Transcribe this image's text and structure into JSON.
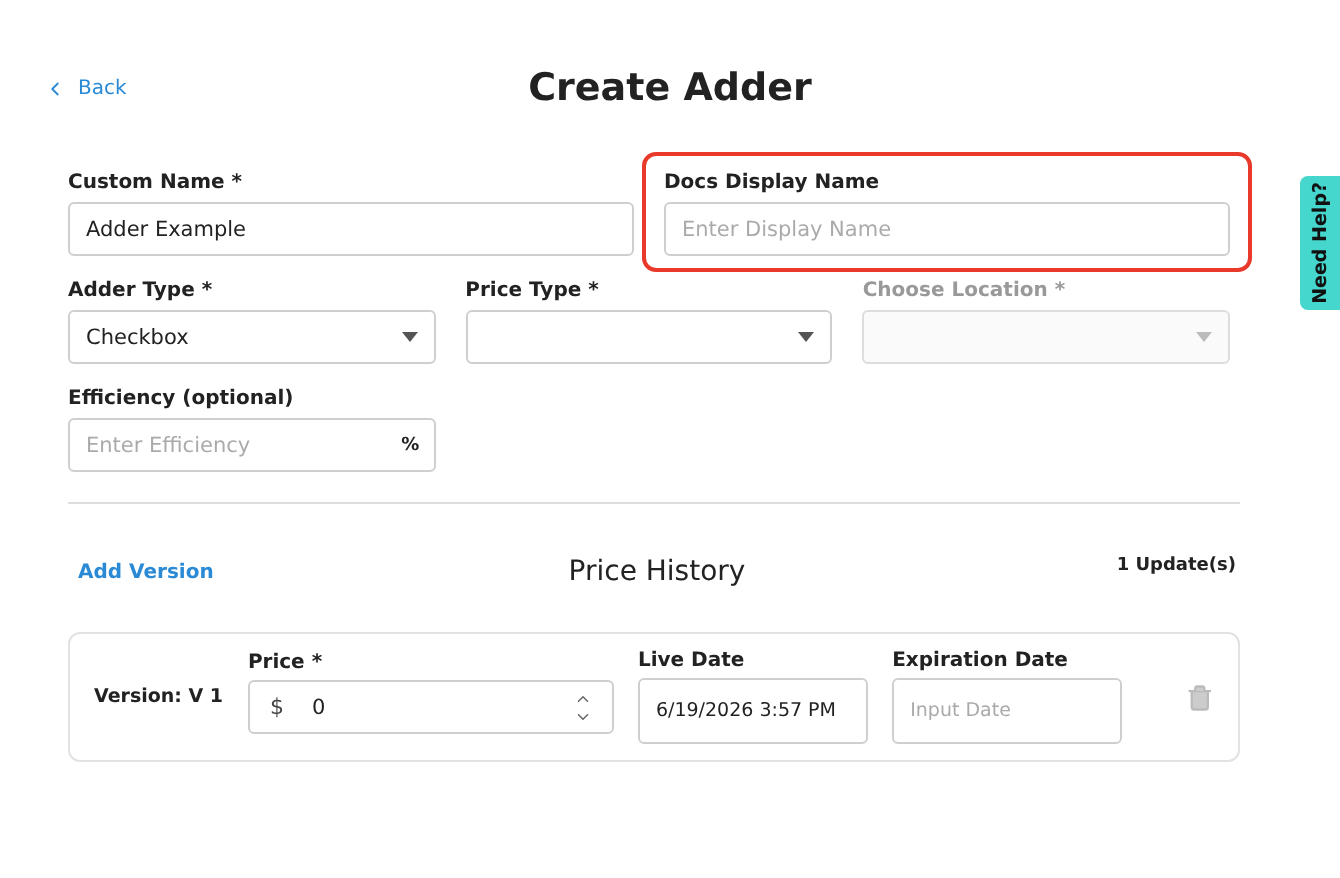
{
  "back_link": {
    "label": "Back"
  },
  "title": "Create Adder",
  "fields": [
    {
      "kind": "text",
      "label": "Custom Name *",
      "value": "Adder Example",
      "highlighted": false,
      "disabled": false
    },
    {
      "kind": "text",
      "label": "Docs Display Name",
      "placeholder": "Enter Display Name",
      "highlighted": true,
      "disabled": false
    },
    {
      "kind": "select",
      "label": "Adder Type *",
      "value": "Checkbox",
      "highlighted": false,
      "disabled": false
    },
    {
      "kind": "select",
      "label": "Price Type *",
      "highlighted": false,
      "disabled": false
    },
    {
      "kind": "select",
      "label": "Choose Location *",
      "highlighted": false,
      "disabled": true
    },
    {
      "kind": "unit",
      "label": "Efficiency (optional)",
      "placeholder": "Enter Efficiency",
      "unit": "%",
      "highlighted": false,
      "disabled": false
    }
  ],
  "help_tab": {
    "label": "Need Help?"
  },
  "price_history": {
    "add_link": "Add Version",
    "title": "Price History",
    "count": "1 Update(s)",
    "versions": [
      {
        "version": "Version: V 1",
        "price_label": "Price *",
        "currency": "$",
        "price": "0",
        "live_label": "Live Date",
        "live_date": "6/19/2026 3:57 PM",
        "expiration_label": "Expiration Date",
        "expiration_placeholder": "Input Date"
      }
    ]
  }
}
